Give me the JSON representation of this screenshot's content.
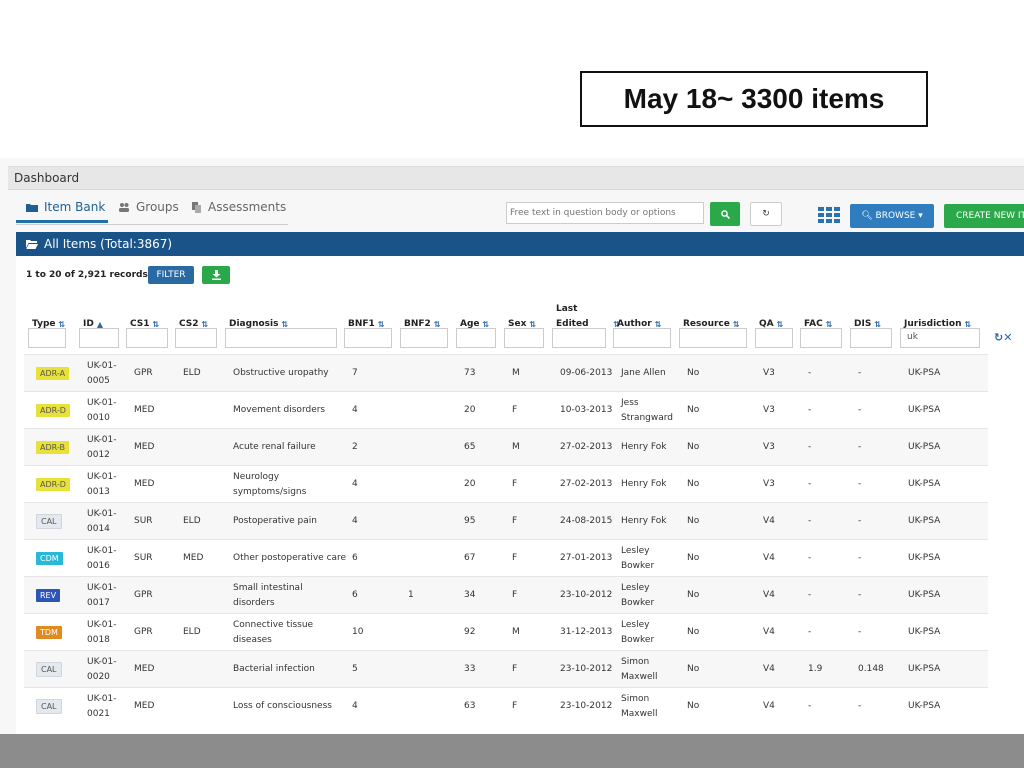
{
  "annotation": {
    "text": "May 18~ 3300 items"
  },
  "dashboard": {
    "label": "Dashboard"
  },
  "tabs": [
    {
      "label": "Item Bank",
      "icon": "user-icon"
    },
    {
      "label": "Groups",
      "icon": "users-icon"
    },
    {
      "label": "Assessments",
      "icon": "copy-icon"
    }
  ],
  "search": {
    "placeholder": "Free text in question body or options"
  },
  "toolbar": {
    "browse_label": "BROWSE",
    "create_label": "CREATE NEW IT"
  },
  "panel": {
    "title": "All Items (Total:3867)"
  },
  "records": {
    "text": "1 to 20 of 2,921 records",
    "filter_label": "FILTER"
  },
  "columns": [
    {
      "label": "Type",
      "sort": "both"
    },
    {
      "label": "ID",
      "sort": "asc"
    },
    {
      "label": "CS1",
      "sort": "both"
    },
    {
      "label": "CS2",
      "sort": "both"
    },
    {
      "label": "Diagnosis",
      "sort": "both"
    },
    {
      "label": "BNF1",
      "sort": "both"
    },
    {
      "label": "BNF2",
      "sort": "both"
    },
    {
      "label": "Age",
      "sort": "both"
    },
    {
      "label": "Sex",
      "sort": "both"
    },
    {
      "label": "Last Edited",
      "sort": "both"
    },
    {
      "label": "Author",
      "sort": "both"
    },
    {
      "label": "Resource",
      "sort": "both"
    },
    {
      "label": "QA",
      "sort": "both"
    },
    {
      "label": "FAC",
      "sort": "both"
    },
    {
      "label": "DIS",
      "sort": "both"
    },
    {
      "label": "Jurisdiction",
      "sort": "both"
    }
  ],
  "filters": {
    "jurisdiction_value": "uk"
  },
  "badge_colors": {
    "ADR": "#e8e13a",
    "CAL": "#e3e9ef",
    "CDM": "#29b8d8",
    "REV": "#2d55b5",
    "TDM": "#e08a1f"
  },
  "rows": [
    {
      "type": "ADR-A",
      "id": "UK-01-0005",
      "cs1": "GPR",
      "cs2": "ELD",
      "diagnosis": "Obstructive uropathy",
      "bnf1": "7",
      "bnf2": "",
      "age": "73",
      "sex": "M",
      "edited": "09-06-2013",
      "author": "Jane Allen",
      "resource": "No",
      "qa": "V3",
      "fac": "-",
      "dis": "-",
      "jurisdiction": "UK-PSA"
    },
    {
      "type": "ADR-D",
      "id": "UK-01-0010",
      "cs1": "MED",
      "cs2": "",
      "diagnosis": "Movement disorders",
      "bnf1": "4",
      "bnf2": "",
      "age": "20",
      "sex": "F",
      "edited": "10-03-2013",
      "author": "Jess Strangward",
      "resource": "No",
      "qa": "V3",
      "fac": "-",
      "dis": "-",
      "jurisdiction": "UK-PSA"
    },
    {
      "type": "ADR-B",
      "id": "UK-01-0012",
      "cs1": "MED",
      "cs2": "",
      "diagnosis": "Acute renal failure",
      "bnf1": "2",
      "bnf2": "",
      "age": "65",
      "sex": "M",
      "edited": "27-02-2013",
      "author": "Henry Fok",
      "resource": "No",
      "qa": "V3",
      "fac": "-",
      "dis": "-",
      "jurisdiction": "UK-PSA"
    },
    {
      "type": "ADR-D",
      "id": "UK-01-0013",
      "cs1": "MED",
      "cs2": "",
      "diagnosis": "Neurology symptoms/signs",
      "bnf1": "4",
      "bnf2": "",
      "age": "20",
      "sex": "F",
      "edited": "27-02-2013",
      "author": "Henry Fok",
      "resource": "No",
      "qa": "V3",
      "fac": "-",
      "dis": "-",
      "jurisdiction": "UK-PSA"
    },
    {
      "type": "CAL",
      "id": "UK-01-0014",
      "cs1": "SUR",
      "cs2": "ELD",
      "diagnosis": "Postoperative pain",
      "bnf1": "4",
      "bnf2": "",
      "age": "95",
      "sex": "F",
      "edited": "24-08-2015",
      "author": "Henry Fok",
      "resource": "No",
      "qa": "V4",
      "fac": "-",
      "dis": "-",
      "jurisdiction": "UK-PSA"
    },
    {
      "type": "CDM",
      "id": "UK-01-0016",
      "cs1": "SUR",
      "cs2": "MED",
      "diagnosis": "Other postoperative care",
      "bnf1": "6",
      "bnf2": "",
      "age": "67",
      "sex": "F",
      "edited": "27-01-2013",
      "author": "Lesley Bowker",
      "resource": "No",
      "qa": "V4",
      "fac": "-",
      "dis": "-",
      "jurisdiction": "UK-PSA"
    },
    {
      "type": "REV",
      "id": "UK-01-0017",
      "cs1": "GPR",
      "cs2": "",
      "diagnosis": "Small intestinal disorders",
      "bnf1": "6",
      "bnf2": "1",
      "age": "34",
      "sex": "F",
      "edited": "23-10-2012",
      "author": "Lesley Bowker",
      "resource": "No",
      "qa": "V4",
      "fac": "-",
      "dis": "-",
      "jurisdiction": "UK-PSA"
    },
    {
      "type": "TDM",
      "id": "UK-01-0018",
      "cs1": "GPR",
      "cs2": "ELD",
      "diagnosis": "Connective tissue diseases",
      "bnf1": "10",
      "bnf2": "",
      "age": "92",
      "sex": "M",
      "edited": "31-12-2013",
      "author": "Lesley Bowker",
      "resource": "No",
      "qa": "V4",
      "fac": "-",
      "dis": "-",
      "jurisdiction": "UK-PSA"
    },
    {
      "type": "CAL",
      "id": "UK-01-0020",
      "cs1": "MED",
      "cs2": "",
      "diagnosis": "Bacterial infection",
      "bnf1": "5",
      "bnf2": "",
      "age": "33",
      "sex": "F",
      "edited": "23-10-2012",
      "author": "Simon Maxwell",
      "resource": "No",
      "qa": "V4",
      "fac": "1.9",
      "dis": "0.148",
      "jurisdiction": "UK-PSA"
    },
    {
      "type": "CAL",
      "id": "UK-01-0021",
      "cs1": "MED",
      "cs2": "",
      "diagnosis": "Loss of consciousness",
      "bnf1": "4",
      "bnf2": "",
      "age": "63",
      "sex": "F",
      "edited": "23-10-2012",
      "author": "Simon Maxwell",
      "resource": "No",
      "qa": "V4",
      "fac": "-",
      "dis": "-",
      "jurisdiction": "UK-PSA"
    }
  ]
}
